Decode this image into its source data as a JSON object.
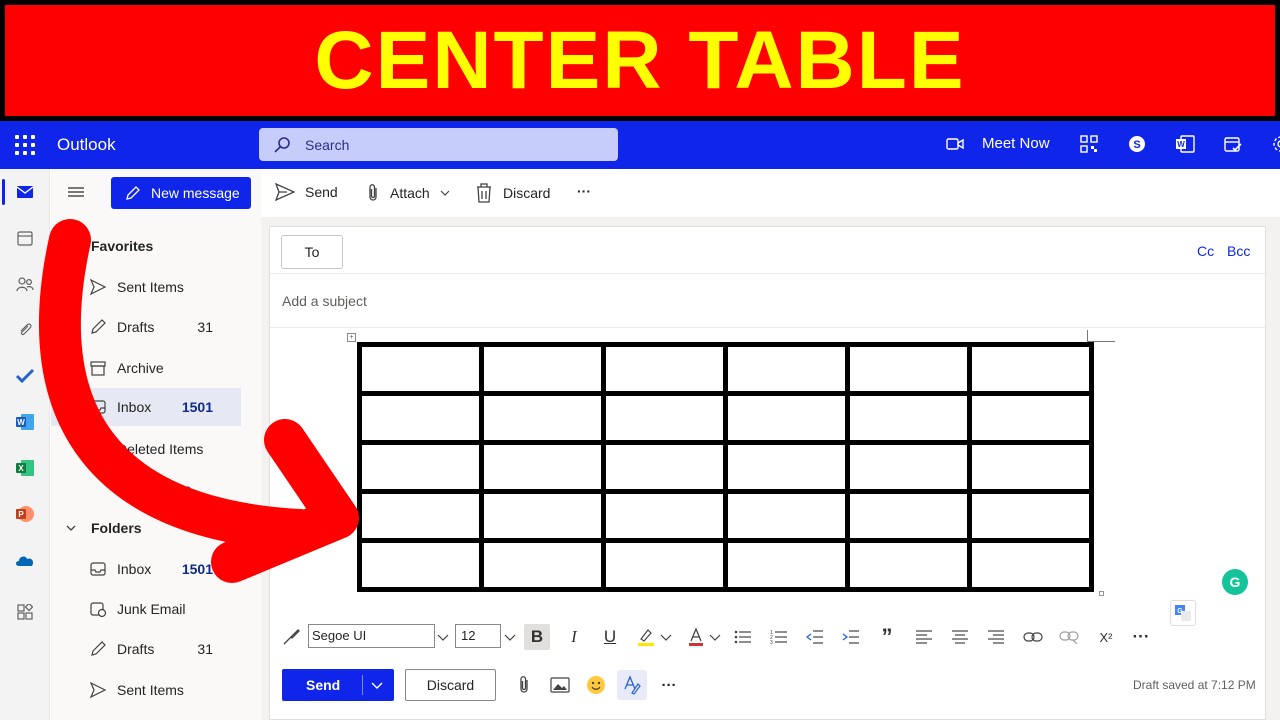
{
  "banner": {
    "title": "CENTER TABLE"
  },
  "topbar": {
    "app_title": "Outlook",
    "search_placeholder": "Search",
    "meet_now_label": "Meet Now",
    "icons": [
      "qr-code-icon",
      "skype-icon",
      "office-word-icon",
      "calendar-task-icon",
      "settings-icon"
    ]
  },
  "rail": {
    "icons": [
      "mail-icon",
      "calendar-icon",
      "people-icon",
      "attach-icon",
      "todo-check-icon",
      "word-icon",
      "excel-icon",
      "powerpoint-icon",
      "onedrive-icon",
      "apps-icon"
    ]
  },
  "folder_pane": {
    "favorites_label": "Favorites",
    "favorites": [
      {
        "label": "Sent Items",
        "count": ""
      },
      {
        "label": "Drafts",
        "count": "31"
      },
      {
        "label": "Archive",
        "count": ""
      },
      {
        "label": "Inbox",
        "count": "1501"
      },
      {
        "label": "Deleted Items",
        "count": ""
      }
    ],
    "add_favorite_label": "Add favorite",
    "folders_label": "Folders",
    "folders": [
      {
        "label": "Inbox",
        "count": "1501"
      },
      {
        "label": "Junk Email",
        "count": ""
      },
      {
        "label": "Drafts",
        "count": "31"
      },
      {
        "label": "Sent Items",
        "count": ""
      }
    ]
  },
  "command_bar": {
    "new_message_label": "New message",
    "send_label": "Send",
    "attach_label": "Attach",
    "discard_label": "Discard",
    "more_label": "···"
  },
  "compose": {
    "to_label": "To",
    "cc_label": "Cc",
    "bcc_label": "Bcc",
    "subject_placeholder": "Add a subject",
    "table": {
      "rows": 5,
      "cols": 6
    }
  },
  "format_toolbar": {
    "font_name": "Segoe UI",
    "font_size": "12",
    "bold": "B",
    "italic": "I",
    "underline": "U",
    "quote": "”",
    "superscript": "X²",
    "more": "···"
  },
  "send_bar": {
    "send_label": "Send",
    "discard_label": "Discard",
    "more": "···",
    "draft_status": "Draft saved at 7:12 PM"
  },
  "colors": {
    "banner_red": "#ff0000",
    "banner_yellow": "#ffff00",
    "brand_blue": "#0f26ea",
    "arrow_red": "#ff0000"
  }
}
